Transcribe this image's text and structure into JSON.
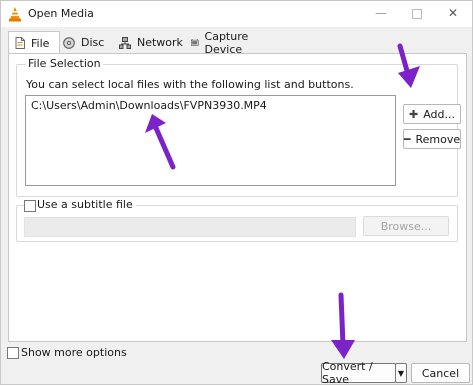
{
  "window": {
    "title": "Open Media",
    "icon": "vlc-cone-icon",
    "controls": [
      "minimize",
      "maximize",
      "close"
    ]
  },
  "tabs": [
    {
      "label": "File",
      "icon": "file-icon",
      "selected": true
    },
    {
      "label": "Disc",
      "icon": "disc-icon",
      "selected": false
    },
    {
      "label": "Network",
      "icon": "network-icon",
      "selected": false
    },
    {
      "label": "Capture Device",
      "icon": "capture-device-icon",
      "selected": false
    }
  ],
  "file_selection": {
    "legend": "File Selection",
    "hint": "You can select local files with the following list and buttons.",
    "files": [
      "C:\\Users\\Admin\\Downloads\\FVPN3930.MP4"
    ],
    "add_label": "Add...",
    "remove_label": "Remove"
  },
  "subtitle": {
    "label": "Use a subtitle file",
    "checked": false,
    "path_value": "",
    "browse_label": "Browse..."
  },
  "show_more": {
    "label": "Show more options",
    "checked": false
  },
  "footer": {
    "convert_label": "Convert / Save",
    "dropdown_symbol": "▼",
    "cancel_label": "Cancel"
  },
  "annotations": {
    "arrow_color": "#7b22c9"
  }
}
